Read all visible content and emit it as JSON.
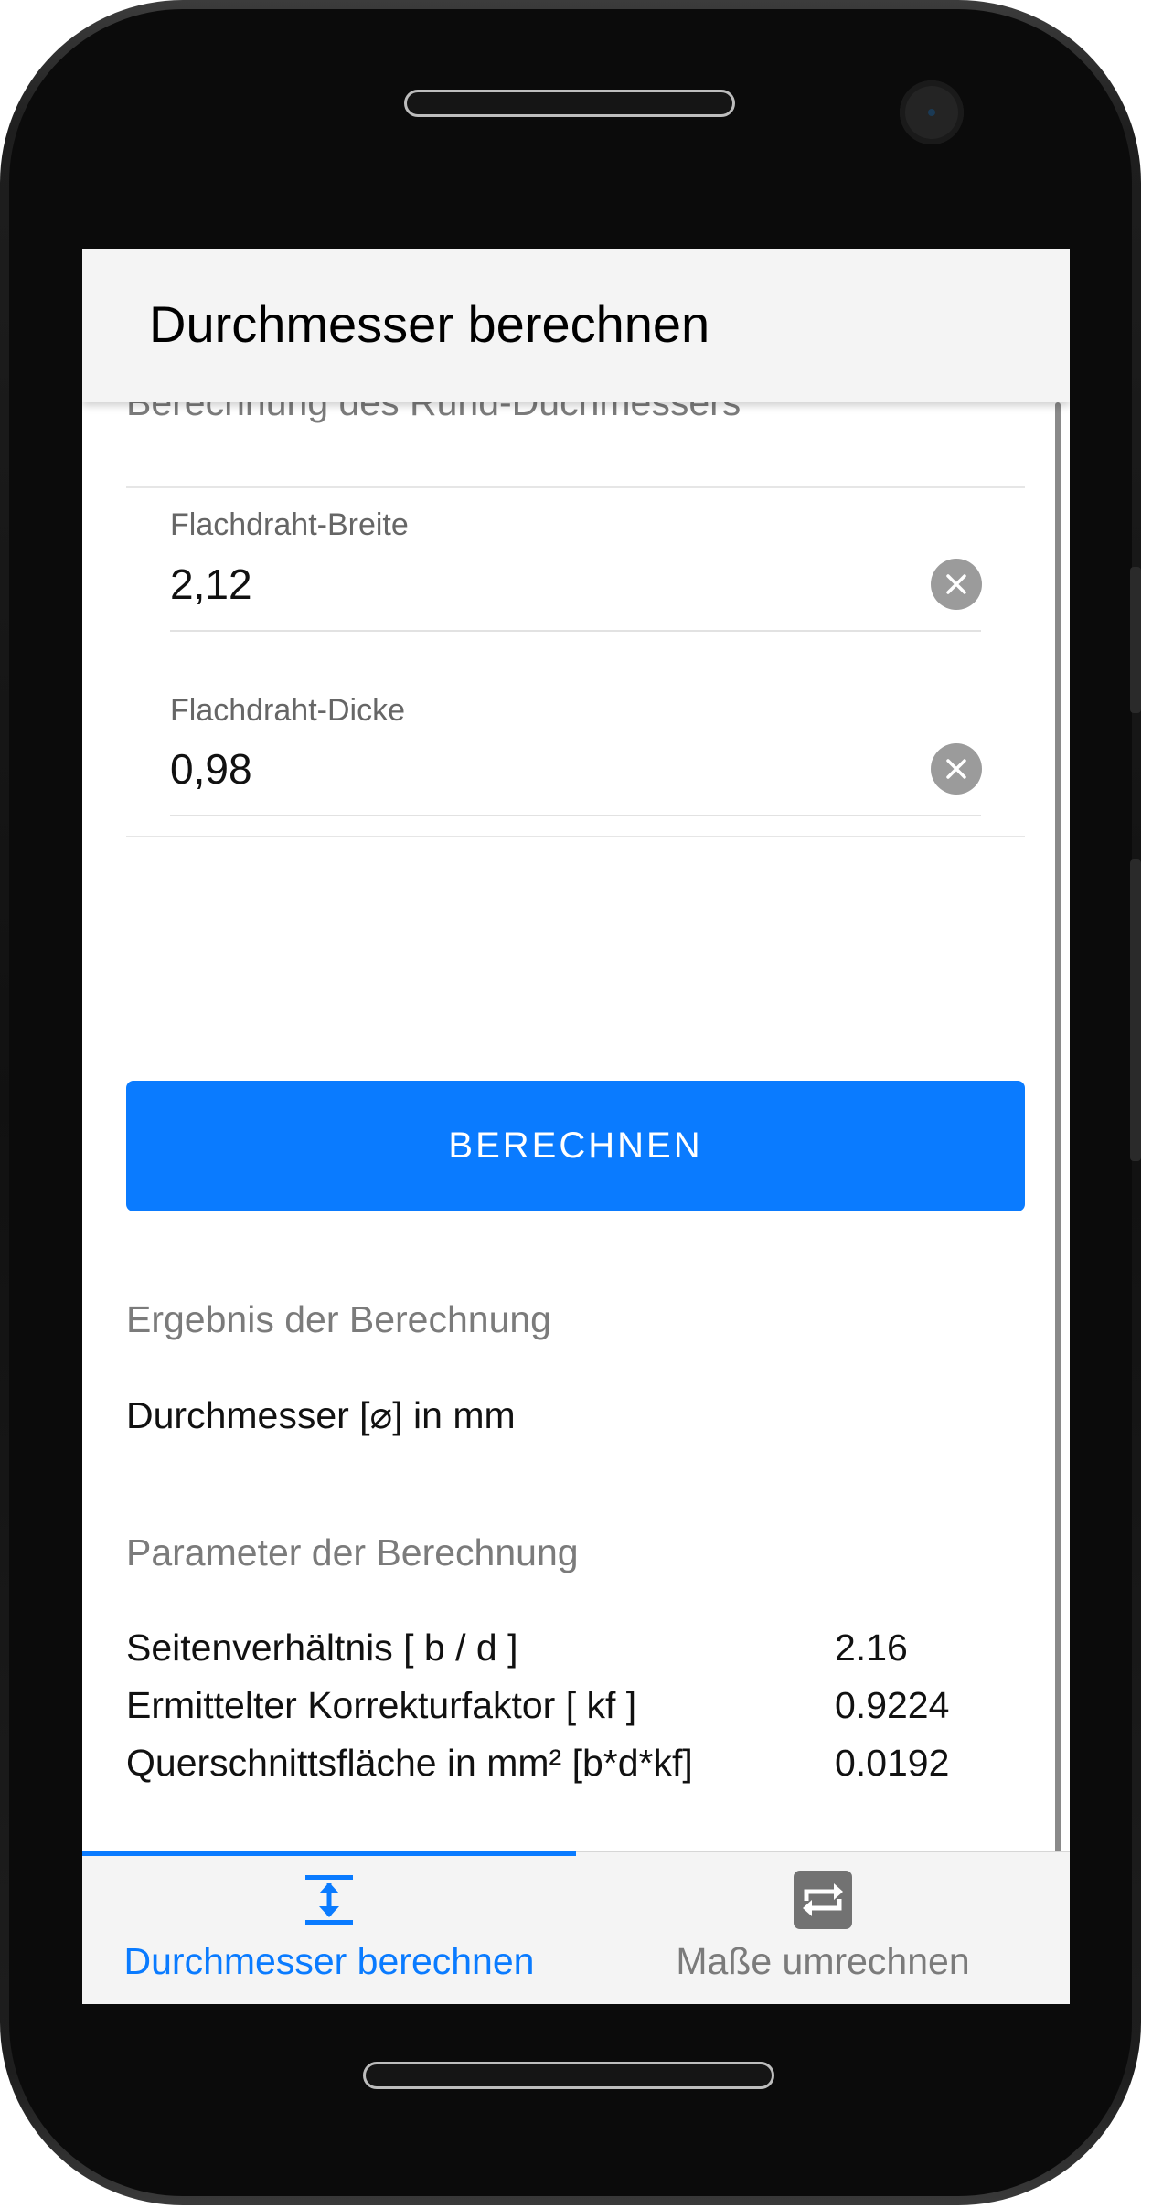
{
  "header": {
    "title": "Durchmesser berechnen"
  },
  "form": {
    "section_title": "Berechnung des Rund-Duchmessers",
    "fields": [
      {
        "label": "Flachdraht-Breite",
        "value": "2,12"
      },
      {
        "label": "Flachdraht-Dicke",
        "value": "0,98"
      }
    ],
    "submit_label": "BERECHNEN"
  },
  "result": {
    "section_title": "Ergebnis der Berechnung",
    "text": "Durchmesser [⌀] in mm"
  },
  "parameters": {
    "section_title": "Parameter der Berechnung",
    "rows": [
      {
        "label": "Seitenverhältnis [ b / d ]",
        "value": "2.16"
      },
      {
        "label": "Ermittelter Korrekturfaktor [ kf ]",
        "value": "0.9224"
      },
      {
        "label": "Querschnittsfläche in mm² [b*d*kf]",
        "value": "0.0192"
      }
    ]
  },
  "tabs": [
    {
      "label": "Durchmesser berechnen",
      "icon": "vertical-resize-icon",
      "active": true
    },
    {
      "label": "Maße umrechnen",
      "icon": "swap-icon",
      "active": false
    }
  ],
  "colors": {
    "accent": "#0a7bff",
    "muted_text": "#7b7b7b",
    "header_bg": "#f4f4f4"
  }
}
